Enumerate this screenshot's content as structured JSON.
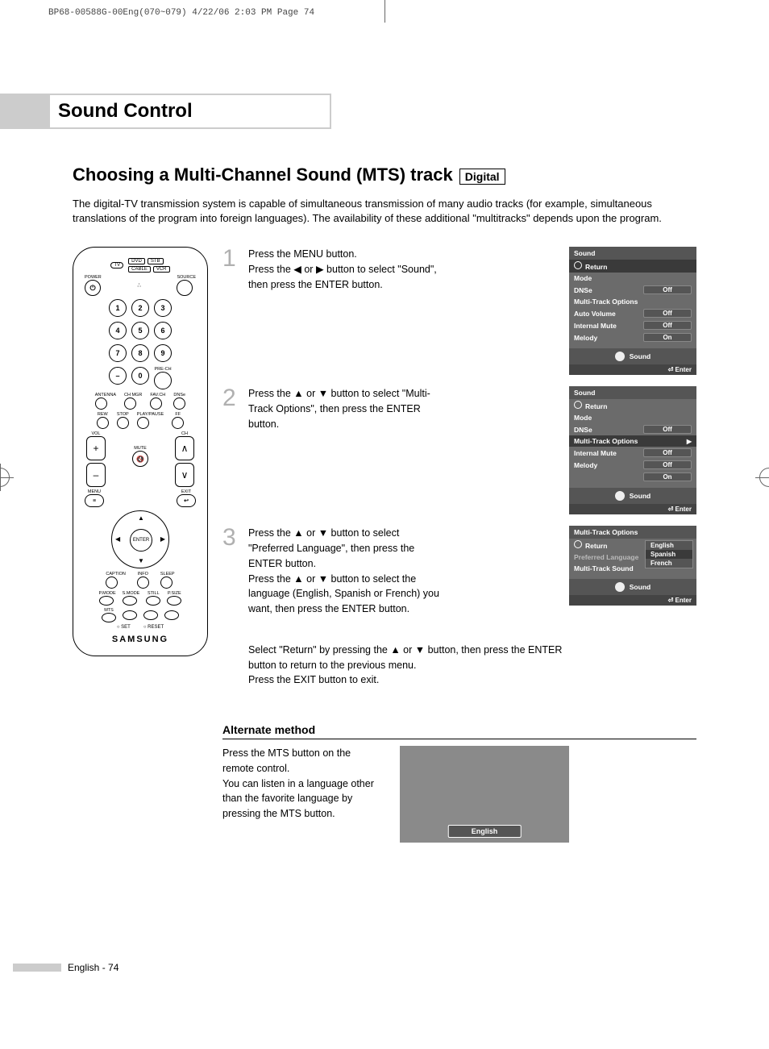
{
  "slug": "BP68-00588G-00Eng(070~079)  4/22/06  2:03 PM  Page 74",
  "section_title": "Sound Control",
  "heading": "Choosing a Multi-Channel Sound (MTS) track",
  "digital_tag": "Digital",
  "intro": "The digital-TV transmission system is capable of simultaneous transmission of many audio tracks (for example, simultaneous translations of the program into foreign languages). The availability of these additional \"multitracks\" depends upon the program.",
  "remote": {
    "mode_tv": "TV",
    "modes": [
      "DVD",
      "STB",
      "CABLE",
      "VCR"
    ],
    "power": "POWER",
    "source": "SOURCE",
    "numbers": [
      "1",
      "2",
      "3",
      "4",
      "5",
      "6",
      "7",
      "8",
      "9",
      "–",
      "0"
    ],
    "prech": "PRE-CH",
    "row_a": [
      "ANTENNA",
      "CH MGR",
      "FAV.CH",
      "DNSe"
    ],
    "row_b": [
      "REW",
      "STOP",
      "PLAY/PAUSE",
      "FF"
    ],
    "vol": "VOL",
    "ch": "CH",
    "mute": "MUTE",
    "menu": "MENU",
    "exit": "EXIT",
    "enter": "ENTER",
    "row_c": [
      "CAPTION",
      "INFO",
      "SLEEP"
    ],
    "row_d": [
      "P.MODE",
      "S.MODE",
      "STILL",
      "P.SIZE"
    ],
    "mts": "MTS",
    "set": "SET",
    "reset": "RESET",
    "brand": "SAMSUNG"
  },
  "steps": {
    "s1": {
      "num": "1",
      "text": "Press the MENU button.\nPress the ◀ or ▶ button to select \"Sound\", then press the ENTER button."
    },
    "s2": {
      "num": "2",
      "text": "Press the ▲ or ▼ button to select \"Multi-Track Options\", then press the ENTER button."
    },
    "s3": {
      "num": "3",
      "text": "Press the ▲ or ▼ button to select \"Preferred Language\", then press the ENTER button.\nPress the ▲ or ▼ button to select the language (English, Spanish or French) you want, then press the ENTER button."
    },
    "return_note": "Select \"Return\" by pressing the ▲ or ▼ button, then press the ENTER button to return to the previous menu.\nPress the EXIT button to exit."
  },
  "osd1": {
    "title": "Sound",
    "return": "Return",
    "rows": [
      {
        "label": "Mode",
        "val": ""
      },
      {
        "label": "DNSe",
        "val": "Off"
      },
      {
        "label": "Multi-Track Options",
        "val": ""
      },
      {
        "label": "Auto Volume",
        "val": "Off"
      },
      {
        "label": "Internal Mute",
        "val": "Off"
      },
      {
        "label": "Melody",
        "val": "On"
      }
    ],
    "footer": "Sound",
    "enter": "Enter"
  },
  "osd2": {
    "title": "Sound",
    "return": "Return",
    "rows": [
      {
        "label": "Mode",
        "val": ""
      },
      {
        "label": "DNSe",
        "val": "Off"
      },
      {
        "label": "Multi-Track Options",
        "val": "",
        "hl": true,
        "arrow": true
      },
      {
        "label": "Internal Mute",
        "val": "Off"
      },
      {
        "label": "Melody",
        "val": "Off"
      },
      {
        "label": "",
        "val": "On"
      }
    ],
    "footer": "Sound",
    "enter": "Enter"
  },
  "osd3": {
    "title": "Multi-Track Options",
    "return": "Return",
    "rows": [
      {
        "label": "Preferred Language",
        "dim": true
      },
      {
        "label": "Multi-Track Sound"
      }
    ],
    "popup": [
      "English",
      "Spanish",
      "French"
    ],
    "popup_sel": "Spanish",
    "footer": "Sound",
    "enter": "Enter"
  },
  "alt": {
    "heading": "Alternate method",
    "text": "Press the MTS button on the remote control.\nYou can listen in a language other than the favorite language by pressing the MTS button.",
    "badge": "English"
  },
  "footer_text": "English - 74"
}
